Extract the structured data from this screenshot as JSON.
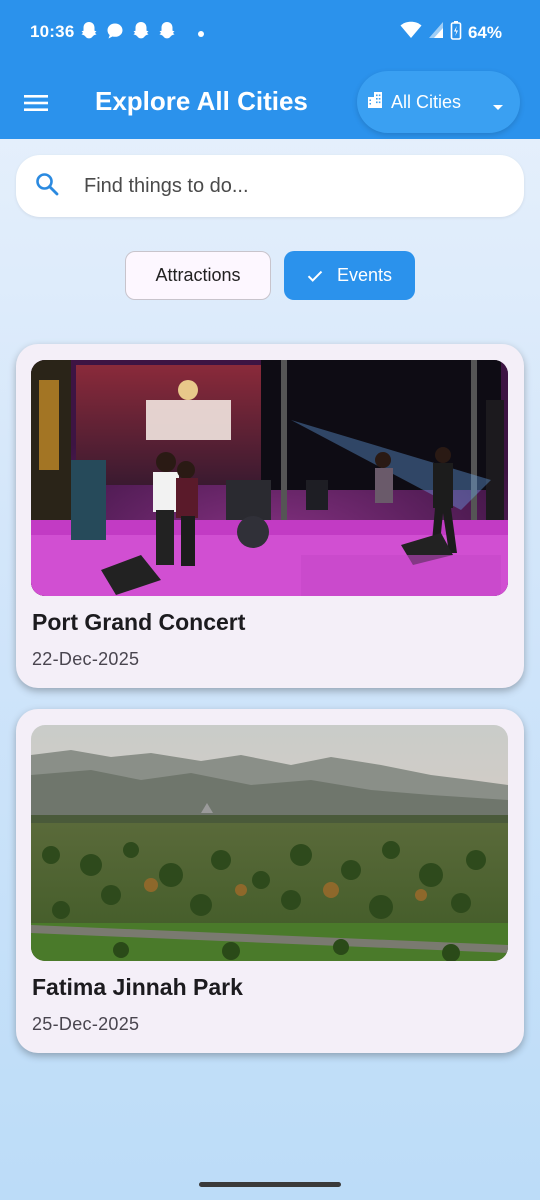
{
  "status_bar": {
    "time": "10:36",
    "battery": "64%"
  },
  "app_bar": {
    "title": "Explore All Cities",
    "city_selector": "All Cities"
  },
  "search": {
    "placeholder": "Find things to do..."
  },
  "filters": {
    "chips": [
      {
        "label": "Attractions",
        "selected": false
      },
      {
        "label": "Events",
        "selected": true
      }
    ]
  },
  "cards": [
    {
      "title": "Port Grand Concert",
      "date": "22-Dec-2025",
      "image": "concert-stage-photo"
    },
    {
      "title": "Fatima Jinnah Park",
      "date": "25-Dec-2025",
      "image": "park-mountains-photo"
    }
  ],
  "colors": {
    "primary": "#2b92ec",
    "card_bg": "#f4eff8",
    "page_bg": "#d3e6fa"
  }
}
